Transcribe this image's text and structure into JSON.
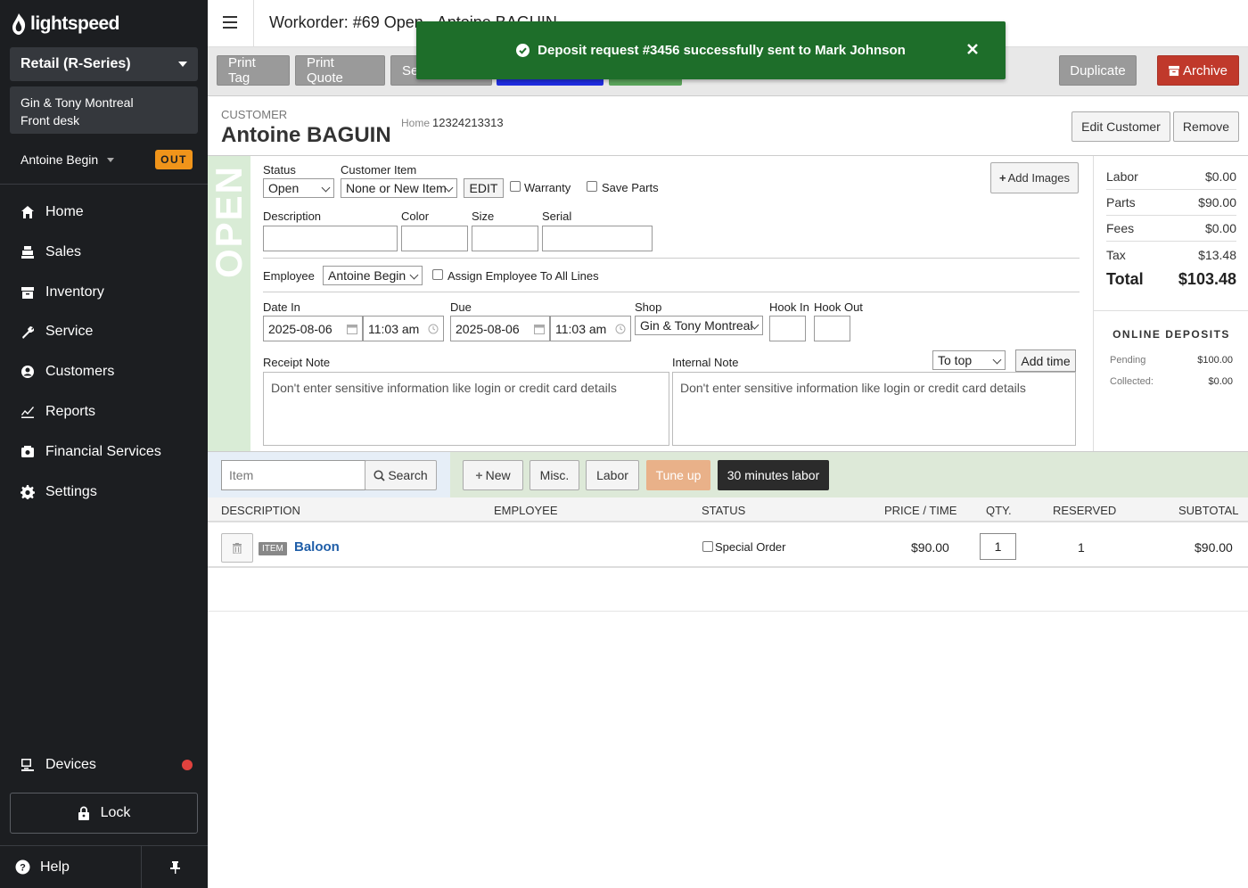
{
  "brand": {
    "name": "lightspeed"
  },
  "sidebar": {
    "store": "Retail (R-Series)",
    "location_line1": "Gin & Tony Montreal",
    "location_line2": "Front desk",
    "user": "Antoine Begin",
    "status_badge": "OUT",
    "nav": [
      {
        "label": "Home",
        "icon": "home-icon"
      },
      {
        "label": "Sales",
        "icon": "sales-icon"
      },
      {
        "label": "Inventory",
        "icon": "inventory-icon"
      },
      {
        "label": "Service",
        "icon": "service-icon"
      },
      {
        "label": "Customers",
        "icon": "customers-icon"
      },
      {
        "label": "Reports",
        "icon": "reports-icon"
      },
      {
        "label": "Financial Services",
        "icon": "financial-icon"
      },
      {
        "label": "Settings",
        "icon": "gear-icon"
      }
    ],
    "devices": "Devices",
    "lock": "Lock",
    "help": "Help"
  },
  "header": {
    "title": "Workorder:  #69 Open - Antoine BAGUIN"
  },
  "toolbar": {
    "print_tag": "Print Tag",
    "print_quote": "Print Quote",
    "send_partial": "Se",
    "duplicate": "Duplicate",
    "archive": "Archive"
  },
  "toast": {
    "message": "Deposit request #3456 successfully sent to Mark Johnson"
  },
  "customer": {
    "label": "Customer",
    "name": "Antoine BAGUIN",
    "phone_label": "Home",
    "phone": "12324213313",
    "edit_button": "Edit Customer",
    "remove_button": "Remove"
  },
  "workorder": {
    "status_strip": "OPEN",
    "status_label": "Status",
    "status_value": "Open",
    "customer_item_label": "Customer Item",
    "customer_item_value": "None or New Item",
    "edit_button": "EDIT",
    "warranty_label": "Warranty",
    "save_parts_label": "Save Parts",
    "add_images": "Add Images",
    "description_label": "Description",
    "color_label": "Color",
    "size_label": "Size",
    "serial_label": "Serial",
    "employee_label": "Employee",
    "employee_value": "Antoine Begin",
    "assign_all_label": "Assign Employee To All Lines",
    "date_in_label": "Date In",
    "date_in": "2025-08-06",
    "time_in": "11:03 am",
    "due_label": "Due",
    "due_date": "2025-08-06",
    "due_time": "11:03 am",
    "shop_label": "Shop",
    "shop_value": "Gin & Tony Montreal",
    "hook_in_label": "Hook In",
    "hook_out_label": "Hook Out",
    "receipt_note_label": "Receipt Note",
    "receipt_note_placeholder": "Don't enter sensitive information like login or credit card details",
    "internal_note_label": "Internal Note",
    "internal_note_placeholder": "Don't enter sensitive information like login or credit card details",
    "to_top": "To top",
    "add_time": "Add time"
  },
  "summary": {
    "rows": [
      {
        "label": "Labor",
        "value": "$0.00"
      },
      {
        "label": "Parts",
        "value": "$90.00"
      },
      {
        "label": "Fees",
        "value": "$0.00"
      },
      {
        "label": "Tax",
        "value": "$13.48"
      }
    ],
    "total_label": "Total",
    "total_value": "$103.48",
    "deposits_title": "ONLINE DEPOSITS",
    "pending_label": "Pending",
    "pending_value": "$100.00",
    "collected_label": "Collected:",
    "collected_value": "$0.00"
  },
  "items_bar": {
    "item_placeholder": "Item",
    "search": "Search",
    "new": "New",
    "misc": "Misc.",
    "labor": "Labor",
    "tune_up": "Tune up",
    "labor_30": "30 minutes labor"
  },
  "table": {
    "headers": [
      "DESCRIPTION",
      "EMPLOYEE",
      "STATUS",
      "PRICE / TIME",
      "QTY.",
      "RESERVED",
      "SUBTOTAL"
    ],
    "rows": [
      {
        "badge": "ITEM",
        "description": "Baloon",
        "status": "Special Order",
        "price": "$90.00",
        "qty": "1",
        "reserved": "1",
        "subtotal": "$90.00"
      }
    ]
  }
}
